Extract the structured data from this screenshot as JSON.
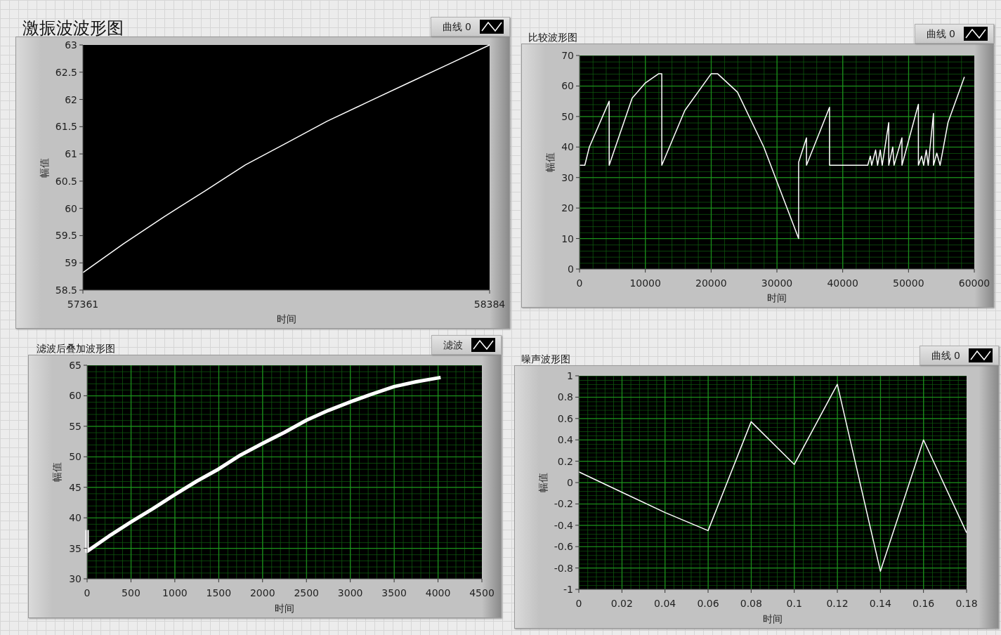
{
  "panels": [
    {
      "title": "激振波波形图",
      "chart_data": {
        "type": "line",
        "grid": false,
        "xlabel": "时间",
        "ylabel": "幅值",
        "xlim": [
          57361,
          58384
        ],
        "ylim": [
          58.5,
          63
        ],
        "xticks": [
          57361,
          58384
        ],
        "yticks": [
          58.5,
          59,
          59.5,
          60,
          60.5,
          61,
          61.5,
          62,
          62.5,
          63
        ],
        "x": [
          57361,
          57463,
          57566,
          57668,
          57770,
          57873,
          57975,
          58077,
          58179,
          58282,
          58384
        ],
        "series": [
          {
            "name": "曲线 0",
            "color": "#ffffff",
            "values": [
              58.82,
              59.35,
              59.85,
              60.32,
              60.8,
              61.2,
              61.6,
              61.95,
              62.3,
              62.65,
              63
            ]
          }
        ]
      }
    },
    {
      "title": "比较波形图",
      "chart_data": {
        "type": "line",
        "grid": true,
        "xlabel": "时间",
        "ylabel": "幅值",
        "xlim": [
          0,
          60000
        ],
        "ylim": [
          0,
          70
        ],
        "xticks": [
          0,
          10000,
          20000,
          30000,
          40000,
          50000,
          60000
        ],
        "yticks": [
          0,
          10,
          20,
          30,
          40,
          50,
          60,
          70
        ],
        "x": [
          0,
          800,
          1500,
          4500,
          4500,
          8000,
          10000,
          12000,
          12500,
          12500,
          16000,
          20000,
          21000,
          24000,
          28000,
          33300,
          33300,
          34500,
          34500,
          38000,
          38000,
          41000,
          43800,
          44200,
          44400,
          45000,
          45300,
          45700,
          46000,
          47000,
          47000,
          47600,
          47800,
          49000,
          49000,
          51500,
          51500,
          52000,
          52300,
          52700,
          53000,
          53800,
          53800,
          54300,
          54800,
          56000,
          58500
        ],
        "series": [
          {
            "name": "曲线 0",
            "color": "#ffffff",
            "values": [
              34,
              34,
              40,
              55,
              34,
              56,
              61,
              64,
              64,
              34,
              52,
              64,
              64,
              58,
              40,
              10,
              35,
              43,
              34,
              53,
              34,
              34,
              34,
              37,
              34,
              39,
              34,
              39,
              34,
              48,
              34,
              40,
              34,
              43,
              34,
              54,
              34,
              37,
              34,
              39,
              34,
              51,
              34,
              38,
              34,
              48,
              63
            ]
          }
        ]
      }
    },
    {
      "title": "滤波后叠加波形图",
      "chart_data": {
        "type": "line",
        "grid": true,
        "xlabel": "时间",
        "ylabel": "幅值",
        "xlim": [
          0,
          4500
        ],
        "ylim": [
          30,
          65
        ],
        "xticks": [
          0,
          500,
          1000,
          1500,
          2000,
          2500,
          3000,
          3500,
          4000,
          4500
        ],
        "yticks": [
          30,
          35,
          40,
          45,
          50,
          55,
          60,
          65
        ],
        "x": [
          0,
          0,
          250,
          500,
          750,
          1000,
          1250,
          1500,
          1750,
          2000,
          2250,
          2500,
          2750,
          3000,
          3250,
          3500,
          3750,
          4030
        ],
        "series": [
          {
            "name": "滤波",
            "color": "#ffffff",
            "values": [
              38,
              34.5,
              37,
              39.3,
              41.5,
              43.8,
              46,
              48,
              50.3,
              52.2,
              54,
              56,
              57.6,
              59,
              60.3,
              61.5,
              62.3,
              63
            ]
          }
        ]
      }
    },
    {
      "title": "噪声波形图",
      "chart_data": {
        "type": "line",
        "grid": true,
        "xlabel": "时间",
        "ylabel": "幅值",
        "xlim": [
          0,
          0.18
        ],
        "ylim": [
          -1,
          1
        ],
        "xticks": [
          0,
          0.02,
          0.04,
          0.06,
          0.08,
          0.1,
          0.12,
          0.14,
          0.16,
          0.18
        ],
        "yticks": [
          -1,
          -0.8,
          -0.6,
          -0.4,
          -0.2,
          0,
          0.2,
          0.4,
          0.6,
          0.8,
          1
        ],
        "x": [
          0,
          0.02,
          0.04,
          0.06,
          0.08,
          0.1,
          0.12,
          0.14,
          0.16,
          0.18
        ],
        "series": [
          {
            "name": "曲线 0",
            "color": "#ffffff",
            "values": [
              0.1,
              -0.09,
              -0.28,
              -0.45,
              0.57,
              0.17,
              0.92,
              -0.83,
              0.4,
              -0.47
            ]
          }
        ]
      }
    }
  ]
}
